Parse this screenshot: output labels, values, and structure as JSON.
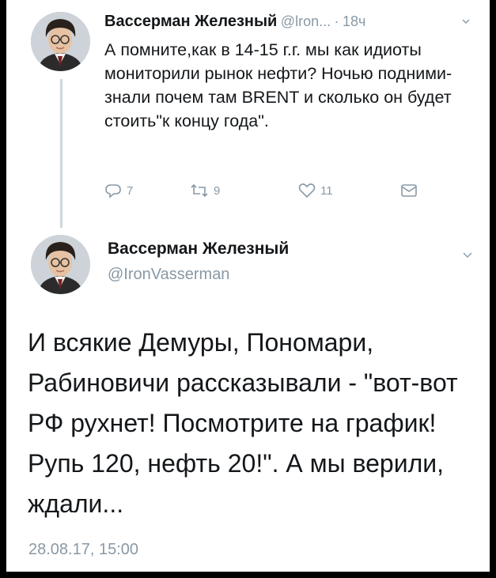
{
  "tweet1": {
    "author_name": "Вассерман Железный",
    "handle_short": "@lron...",
    "separator": "·",
    "time_ago": "18ч",
    "text": "А помните,как в 14-15 г.г. мы как идиоты мониторили рынок нефти? Ночью подними-знали почем там BRENT и сколько он будет стоить\"к концу года\".",
    "replies": "7",
    "retweets": "9",
    "likes": "11",
    "icons": [
      "reply-icon",
      "retweet-icon",
      "like-icon",
      "message-icon",
      "chevron-down-icon"
    ]
  },
  "tweet2": {
    "author_name": "Вассерман Железный",
    "handle": "@IronVasserman",
    "text": "И всякие Демуры, Пономари, Рабиновичи рассказывали - \"вот-вот РФ рухнет! Посмотрите на график! Рупь 120, нефть 20!\". А мы верили, ждали...",
    "timestamp": "28.08.17, 15:00"
  },
  "colors": {
    "background": "#000000",
    "card": "#ffffff",
    "text": "#14171a",
    "muted": "#8899a6",
    "thread_line": "#ccd6dd"
  }
}
